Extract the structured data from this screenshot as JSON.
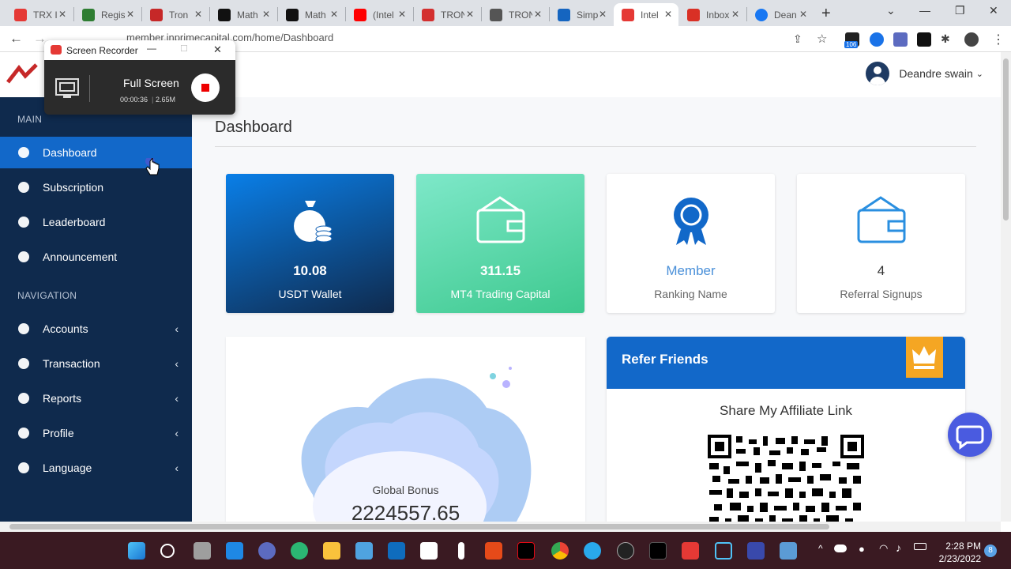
{
  "browser": {
    "tabs": [
      {
        "label": "TRX I",
        "color": "#e53935"
      },
      {
        "label": "Regis",
        "color": "#2e7d32"
      },
      {
        "label": "Tron",
        "color": "#c62828"
      },
      {
        "label": "Math",
        "color": "#111111"
      },
      {
        "label": "Math",
        "color": "#111111"
      },
      {
        "label": "(Intel",
        "color": "#ff0000"
      },
      {
        "label": "TRON",
        "color": "#d32f2f"
      },
      {
        "label": "TRON",
        "color": "#555555"
      },
      {
        "label": "Simp",
        "color": "#1565c0"
      },
      {
        "label": "Intel",
        "color": "#e53935"
      },
      {
        "label": "Inbox",
        "color": "#d93025"
      },
      {
        "label": "Dean",
        "color": "#1877f2"
      }
    ],
    "url": "member.inprimecapital.com/home/Dashboard",
    "extension_badge": "106"
  },
  "recorder": {
    "title": "Screen Recorder",
    "mode": "Full Screen",
    "elapsed": "00:00:36",
    "size": "2.65M"
  },
  "header": {
    "user_name": "Deandre swain"
  },
  "sidebar": {
    "main_heading": "MAIN",
    "nav_heading": "NAVIGATION",
    "main_items": [
      {
        "label": "Dashboard",
        "icon": "globe-icon"
      },
      {
        "label": "Subscription",
        "icon": "gauge-icon"
      },
      {
        "label": "Leaderboard",
        "icon": "award-icon"
      },
      {
        "label": "Announcement",
        "icon": "bell-icon"
      }
    ],
    "nav_items": [
      {
        "label": "Accounts",
        "icon": "users-cog-icon"
      },
      {
        "label": "Transaction",
        "icon": "chat-icon"
      },
      {
        "label": "Reports",
        "icon": "list-icon"
      },
      {
        "label": "Profile",
        "icon": "user-cog-icon"
      },
      {
        "label": "Language",
        "icon": "help-circle-icon"
      }
    ]
  },
  "main": {
    "title": "Dashboard",
    "cards": [
      {
        "value": "10.08",
        "caption": "USDT Wallet"
      },
      {
        "value": "311.15",
        "caption": "MT4 Trading Capital"
      },
      {
        "value": "Member",
        "caption": "Ranking Name"
      },
      {
        "value": "4",
        "caption": "Referral Signups"
      }
    ],
    "bonus_label": "Global Bonus",
    "bonus_value": "2224557.65",
    "refer_title": "Refer Friends",
    "share_label": "Share My Affiliate Link"
  },
  "taskbar": {
    "time": "2:28 PM",
    "date": "2/23/2022",
    "notifications": "8"
  }
}
